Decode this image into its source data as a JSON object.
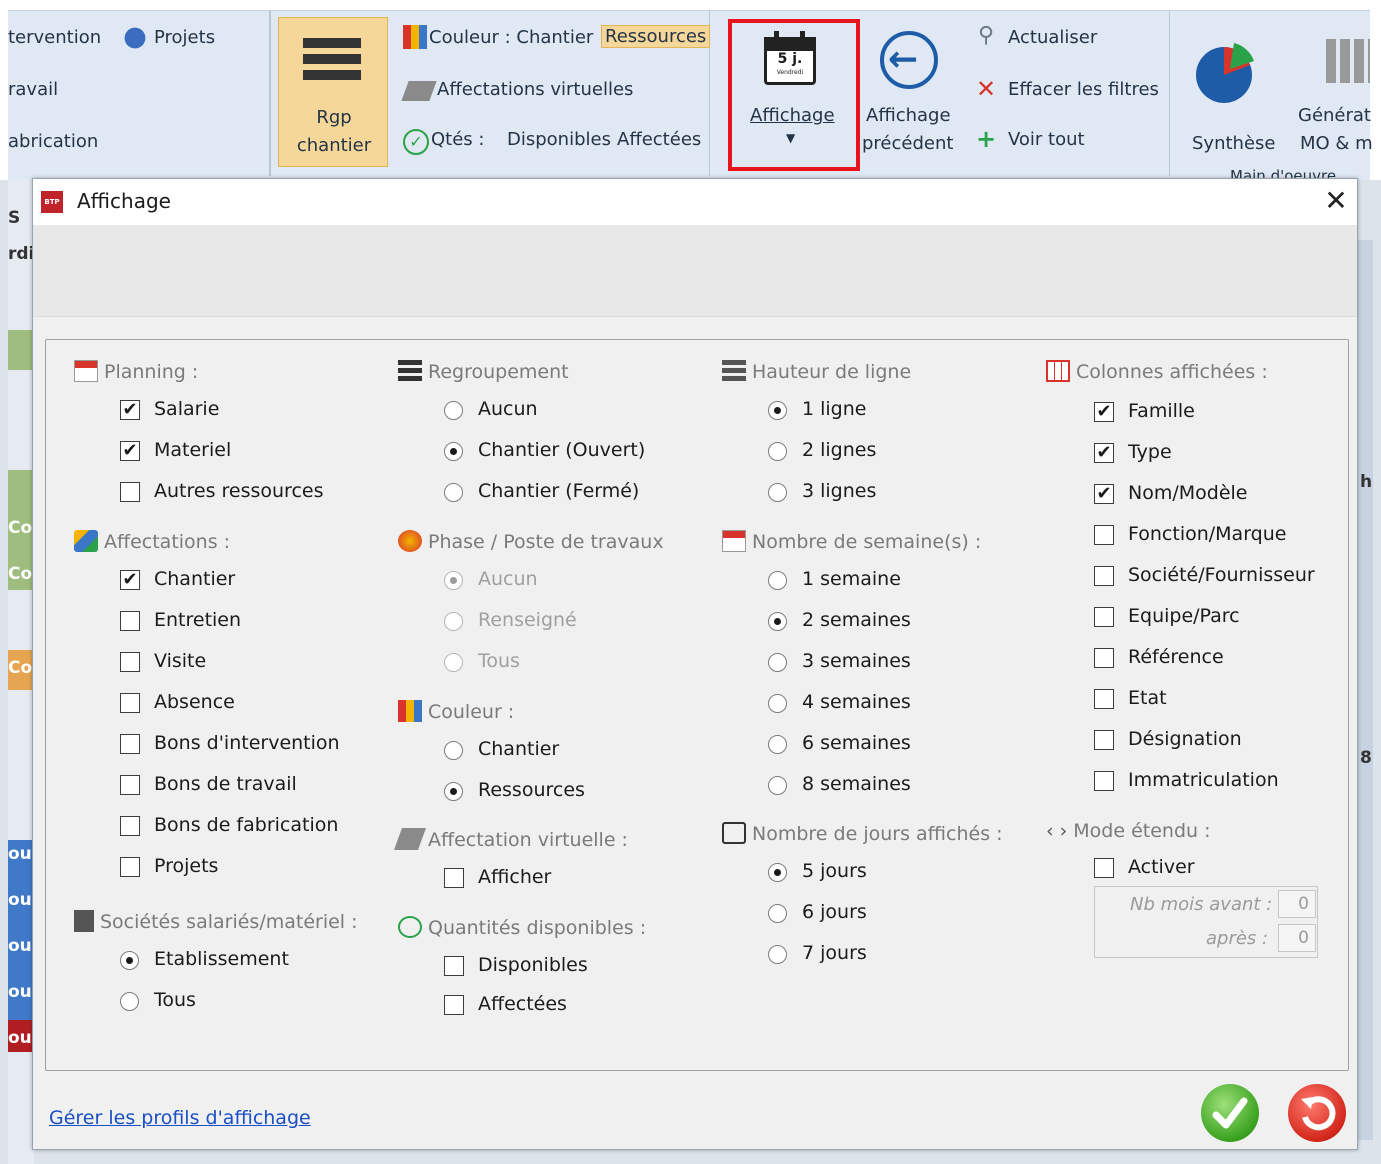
{
  "ribbon": {
    "g1": [
      "tervention",
      "Projets",
      "ravail",
      "abrication"
    ],
    "rgp": [
      "Rgp",
      "chantier"
    ],
    "couleur": "Couleur : Chantier",
    "ressources": "Ressources",
    "aff_virt": "Affectations virtuelles",
    "qtes": "Qtés :",
    "disponibles": "Disponibles",
    "affectees": "Affectées",
    "affichage": "Affichage",
    "cal_label": "5 j.",
    "cal_sub": "Vendredi",
    "aff_prec": [
      "Affichage",
      "précédent"
    ],
    "actualiser": "Actualiser",
    "effacer": "Effacer les filtres",
    "voir_tout": "Voir tout",
    "synthese": "Synthèse",
    "generat": [
      "Générat",
      "MO & m"
    ],
    "group_label": "Main d'oeuvre"
  },
  "bg": {
    "left": [
      "S",
      "rdi",
      "Co",
      "Co",
      "Co",
      "ou",
      "ou",
      "ou",
      "ou",
      "ou"
    ],
    "right": [
      "h",
      "8"
    ]
  },
  "dialog": {
    "title": "Affichage",
    "close": "✕",
    "planning": {
      "label": "Planning :",
      "items": [
        {
          "t": "Salarie",
          "c": true
        },
        {
          "t": "Materiel",
          "c": true
        },
        {
          "t": "Autres ressources",
          "c": false
        }
      ]
    },
    "affectations": {
      "label": "Affectations :",
      "items": [
        {
          "t": "Chantier",
          "c": true
        },
        {
          "t": "Entretien",
          "c": false
        },
        {
          "t": "Visite",
          "c": false
        },
        {
          "t": "Absence",
          "c": false
        },
        {
          "t": "Bons d'intervention",
          "c": false
        },
        {
          "t": "Bons de travail",
          "c": false
        },
        {
          "t": "Bons de fabrication",
          "c": false
        },
        {
          "t": "Projets",
          "c": false
        }
      ]
    },
    "societes": {
      "label": "Sociétés salariés/matériel :",
      "items": [
        {
          "t": "Etablissement",
          "s": true
        },
        {
          "t": "Tous",
          "s": false
        }
      ]
    },
    "regroupement": {
      "label": "Regroupement",
      "items": [
        {
          "t": "Aucun",
          "s": false
        },
        {
          "t": "Chantier (Ouvert)",
          "s": true
        },
        {
          "t": "Chantier (Fermé)",
          "s": false
        }
      ]
    },
    "phase": {
      "label": "Phase / Poste de travaux",
      "items": [
        {
          "t": "Aucun",
          "s": true
        },
        {
          "t": "Renseigné",
          "s": false
        },
        {
          "t": "Tous",
          "s": false
        }
      ]
    },
    "couleur": {
      "label": "Couleur :",
      "items": [
        {
          "t": "Chantier",
          "s": false
        },
        {
          "t": "Ressources",
          "s": true
        }
      ]
    },
    "aff_virt": {
      "label": "Affectation virtuelle :",
      "items": [
        {
          "t": "Afficher",
          "c": false
        }
      ]
    },
    "qte_disp": {
      "label": "Quantités disponibles :",
      "items": [
        {
          "t": "Disponibles",
          "c": false
        },
        {
          "t": "Affectées",
          "c": false
        }
      ]
    },
    "hauteur": {
      "label": "Hauteur de ligne",
      "items": [
        {
          "t": "1 ligne",
          "s": true
        },
        {
          "t": "2 lignes",
          "s": false
        },
        {
          "t": "3 lignes",
          "s": false
        }
      ]
    },
    "semaines": {
      "label": "Nombre de semaine(s) :",
      "items": [
        {
          "t": "1 semaine",
          "s": false
        },
        {
          "t": "2 semaines",
          "s": true
        },
        {
          "t": "3 semaines",
          "s": false
        },
        {
          "t": "4 semaines",
          "s": false
        },
        {
          "t": "6 semaines",
          "s": false
        },
        {
          "t": "8 semaines",
          "s": false
        }
      ]
    },
    "jours": {
      "label": "Nombre de jours affichés :",
      "items": [
        {
          "t": "5 jours",
          "s": true
        },
        {
          "t": "6 jours",
          "s": false
        },
        {
          "t": "7 jours",
          "s": false
        }
      ]
    },
    "colonnes": {
      "label": "Colonnes affichées :",
      "items": [
        {
          "t": "Famille",
          "c": true
        },
        {
          "t": "Type",
          "c": true
        },
        {
          "t": "Nom/Modèle",
          "c": true
        },
        {
          "t": "Fonction/Marque",
          "c": false
        },
        {
          "t": "Société/Fournisseur",
          "c": false
        },
        {
          "t": "Equipe/Parc",
          "c": false
        },
        {
          "t": "Référence",
          "c": false
        },
        {
          "t": "Etat",
          "c": false
        },
        {
          "t": "Désignation",
          "c": false
        },
        {
          "t": "Immatriculation",
          "c": false
        }
      ]
    },
    "mode": {
      "label": "Mode étendu :",
      "activer": {
        "t": "Activer",
        "c": false
      },
      "nb_avant": "Nb mois avant :",
      "apres": "après :",
      "v_avant": "0",
      "v_apres": "0"
    },
    "link": "Gérer les profils d'affichage"
  },
  "colors": {
    "accent": "#f5d79a",
    "highlight": "#e8141c",
    "ok": "#3aa21f",
    "cancel": "#d3271c"
  }
}
